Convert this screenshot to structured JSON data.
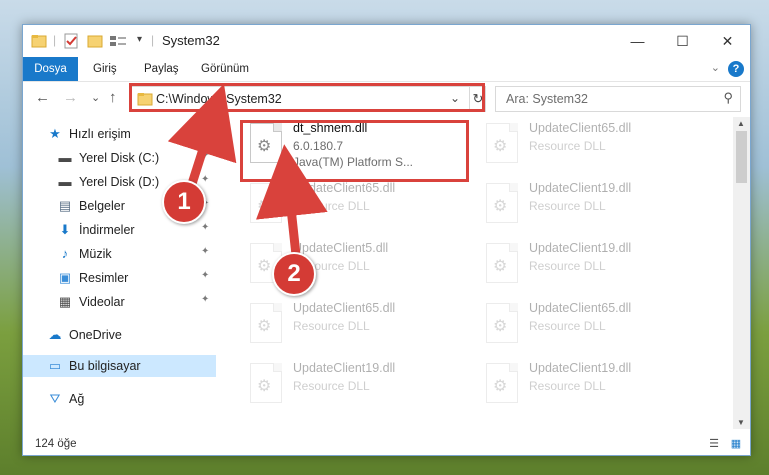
{
  "window": {
    "title": "System32",
    "minimize_icon": "—",
    "maximize_icon": "☐",
    "close_icon": "✕"
  },
  "ribbon": {
    "tabs": [
      "Dosya",
      "Giriş",
      "Paylaş",
      "Görünüm"
    ],
    "help": "?",
    "expand_icon": "⌄"
  },
  "nav": {
    "back": "←",
    "forward": "→",
    "recent": "⌄",
    "up": "↑",
    "address": "C:\\Windows\\System32",
    "address_dropdown": "⌄",
    "refresh": "↻",
    "search_placeholder": "Ara: System32",
    "search_icon": "⚲"
  },
  "sidebar": {
    "items": [
      {
        "label": "Hızlı erişim",
        "icon": "★",
        "icon_color": "#1979ca"
      },
      {
        "label": "Yerel Disk (C:)",
        "icon": "▬",
        "icon_color": "#4a4a4a",
        "pinned": true
      },
      {
        "label": "Yerel Disk (D:)",
        "icon": "▬",
        "icon_color": "#4a4a4a",
        "pinned": true
      },
      {
        "label": "Belgeler",
        "icon": "▤",
        "icon_color": "#5a6f86",
        "pinned": true
      },
      {
        "label": "İndirmeler",
        "icon": "⬇",
        "icon_color": "#1979ca",
        "pinned": true
      },
      {
        "label": "Müzik",
        "icon": "♪",
        "icon_color": "#1979ca",
        "pinned": true
      },
      {
        "label": "Resimler",
        "icon": "▣",
        "icon_color": "#3b8ed8",
        "pinned": true
      },
      {
        "label": "Videolar",
        "icon": "▦",
        "icon_color": "#4a4a4a",
        "pinned": true
      },
      {
        "label": "OneDrive",
        "icon": "☁",
        "icon_color": "#1979ca"
      },
      {
        "label": "Bu bilgisayar",
        "icon": "▭",
        "icon_color": "#3b8ed8"
      },
      {
        "label": "Ağ",
        "icon": "⛛",
        "icon_color": "#3b8ed8"
      }
    ],
    "pin_icon": "✦"
  },
  "files": [
    {
      "name": "dt_shmem.dll",
      "line1": "6.0.180.7",
      "line2": "Java(TM) Platform S..."
    },
    {
      "name": "UpdateClient65.dll",
      "line1": "Resource DLL"
    },
    {
      "name": "UpdateClient65.dll",
      "line1": "Resource DLL"
    },
    {
      "name": "UpdateClient19.dll",
      "line1": "Resource DLL"
    },
    {
      "name": "UpdateClient5.dll",
      "line1": "Resource DLL"
    },
    {
      "name": "UpdateClient19.dll",
      "line1": "Resource DLL"
    },
    {
      "name": "UpdateClient65.dll",
      "line1": "Resource DLL"
    },
    {
      "name": "UpdateClient65.dll",
      "line1": "Resource DLL"
    },
    {
      "name": "UpdateClient19.dll",
      "line1": "Resource DLL"
    },
    {
      "name": "UpdateClient19.dll",
      "line1": "Resource DLL"
    }
  ],
  "gear_icon": "⚙",
  "status": {
    "count": "124 öğe",
    "details_view_icon": "☰",
    "tiles_view_icon": "▦"
  },
  "annotations": {
    "callout_1": "1",
    "callout_2": "2",
    "color": "#d9423c"
  }
}
